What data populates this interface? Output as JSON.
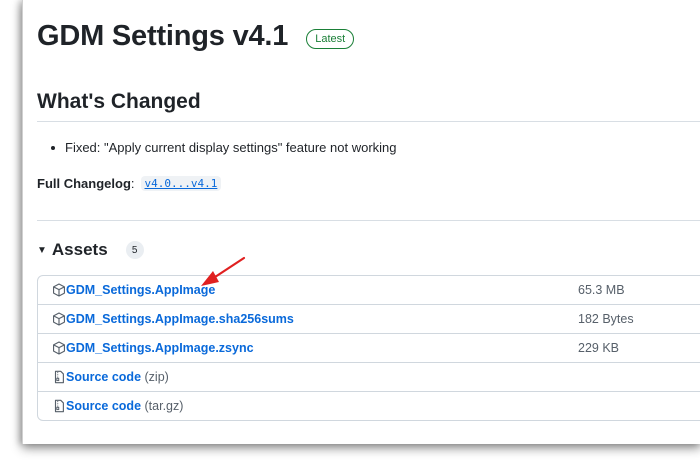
{
  "release": {
    "title": "GDM Settings v4.1",
    "badge": "Latest"
  },
  "whats_changed": {
    "heading": "What's Changed",
    "items": [
      "Fixed: \"Apply current display settings\" feature not working"
    ]
  },
  "changelog": {
    "label": "Full Changelog",
    "separator": ":",
    "link": "v4.0...v4.1"
  },
  "assets": {
    "title": "Assets",
    "count": "5",
    "rows": [
      {
        "name": "GDM_Settings.AppImage",
        "suffix": "",
        "size": "65.3 MB",
        "icon": "package-icon"
      },
      {
        "name": "GDM_Settings.AppImage.sha256sums",
        "suffix": "",
        "size": "182 Bytes",
        "icon": "package-icon"
      },
      {
        "name": "GDM_Settings.AppImage.zsync",
        "suffix": "",
        "size": "229 KB",
        "icon": "package-icon"
      },
      {
        "name": "Source code",
        "suffix": " (zip)",
        "size": "",
        "icon": "file-zip-icon"
      },
      {
        "name": "Source code",
        "suffix": " (tar.gz)",
        "size": "",
        "icon": "file-zip-icon"
      }
    ]
  },
  "colors": {
    "link": "#0969da",
    "badge_green": "#1a7f37",
    "annotation_arrow": "#e02020"
  }
}
